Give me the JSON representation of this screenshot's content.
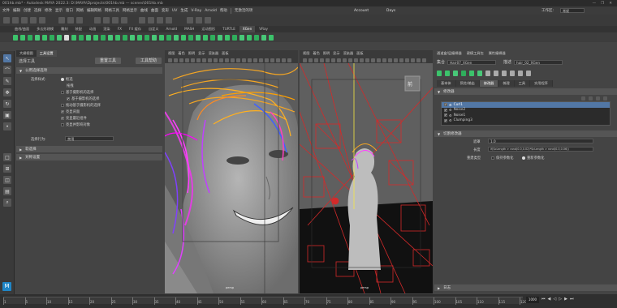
{
  "window": {
    "title": "001hb.mb* - Autodesk MAYA 2022.3: D:\\MAYA\\Dprojects\\001hb.mb — scenes\\001hb.mb",
    "buttons": [
      "—",
      "❐",
      "✕"
    ]
  },
  "menubar": {
    "items": [
      "文件",
      "编辑",
      "创建",
      "选择",
      "修改",
      "显示",
      "窗口",
      "网格",
      "编辑网格",
      "网格工具",
      "网格显示",
      "曲线",
      "曲面",
      "变形",
      "UV",
      "生成",
      "V-Ray",
      "Arnold",
      "帮助"
    ],
    "workspace_mode": "无激活的项",
    "account": "Account",
    "days": "Days",
    "workspace_label": "工作区:",
    "workspace_value": "常规"
  },
  "shelf_tabs": {
    "tabs": [
      "曲线/曲面",
      "多边形建模",
      "雕刻",
      "装配",
      "动画",
      "渲染",
      "FX",
      "FX 缓存",
      "自定义",
      "Arnold",
      "MASH",
      "运动图形",
      "TURTLE",
      "XGen",
      "VRay"
    ],
    "active": 13
  },
  "tool_tabs": {
    "tabs": [
      "大纲视图",
      "工具设置"
    ],
    "active": 1
  },
  "tool_settings": {
    "title": "选择工具",
    "reset_button": "重置工具",
    "help_button": "工具帮助",
    "section_common": "公用选择选项",
    "select_style_label": "选择样式:",
    "select_style_value": "框选",
    "drag_label": "拖拽",
    "checkbox_items": [
      {
        "label": "基于摄影机的选择",
        "checked": false
      },
      {
        "label": "基于摄影机的选择",
        "checked": true
      },
      {
        "label": "拖动基于摄影机的选择",
        "checked": false
      },
      {
        "label": "亮显背面",
        "checked": true
      },
      {
        "label": "亮显最近组件",
        "checked": true
      },
      {
        "label": "亮显并影响对象",
        "checked": false
      }
    ],
    "select_lock_label": "选择行为:",
    "select_lock_value": "禁用",
    "section_soft": "软选择",
    "section_symmetry": "对称设置"
  },
  "viewport_menu": [
    "视图",
    "着色",
    "照明",
    "显示",
    "渲染器",
    "面板"
  ],
  "viewports": [
    {
      "label": "persp"
    },
    {
      "label": "persp"
    }
  ],
  "right_panel": {
    "top_tabs": [
      "通道盒/层编辑器",
      "建模工具包",
      "属性编辑器"
    ],
    "collection_label": "集合",
    "collection_value": "Hair07_XGen",
    "desc_label": "描述",
    "desc_value": "hair_02_XGen",
    "tabs": [
      "基本体",
      "预览/输出",
      "修改器",
      "梳理",
      "工具",
      "实用程序"
    ],
    "active_tab": 2,
    "section_modifiers": "修改器",
    "modifiers": [
      {
        "name": "Curl1",
        "selected": true
      },
      {
        "name": "Noise2",
        "selected": false
      },
      {
        "name": "Noise1",
        "selected": false
      },
      {
        "name": "Clumping3",
        "selected": false
      }
    ],
    "section_curl": "切割修改器",
    "mask_label": "遮罩",
    "mask_value": "1.0",
    "length_label": "长度",
    "length_value": "if($cLength > rand(0.0,0.02)*$cLength > rand(0.0,0.06))",
    "region_label": "重建类型",
    "region_opt1": "保持参数化",
    "region_opt2": "重新参数化",
    "log_label": "日志"
  },
  "timeline": {
    "ticks": [
      "1",
      "5",
      "10",
      "15",
      "20",
      "25",
      "30",
      "35",
      "40",
      "45",
      "50",
      "55",
      "60",
      "65",
      "70",
      "75",
      "80",
      "85",
      "90",
      "95",
      "100",
      "105",
      "110",
      "115",
      "120"
    ],
    "end": "1000"
  },
  "colors": {
    "accent": "#5277a5",
    "menu_bg": "#3c3c3c",
    "panel_bg": "#444444",
    "viewport_bg": "#5f5f5f"
  }
}
